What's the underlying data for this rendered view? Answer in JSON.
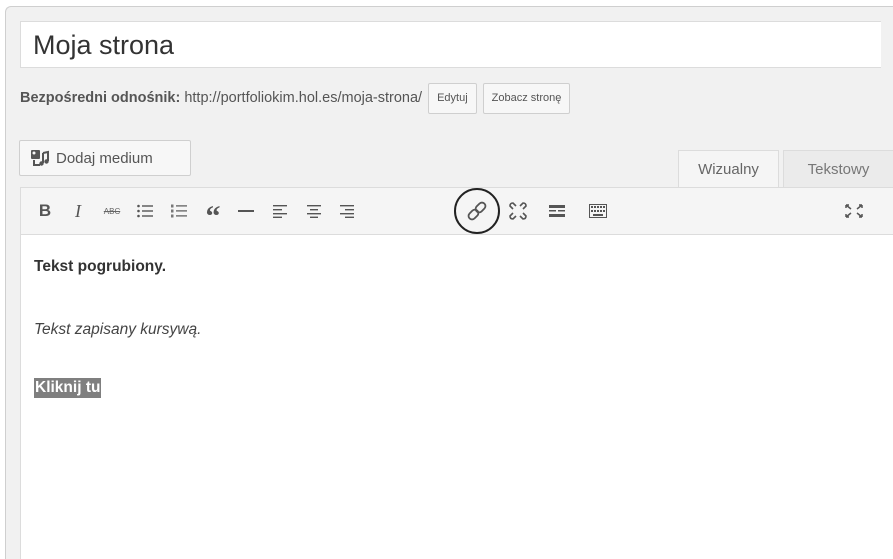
{
  "post": {
    "title": "Moja strona"
  },
  "permalink": {
    "label": "Bezpośredni odnośnik:",
    "url": "http://portfoliokim.hol.es/moja-strona/",
    "edit_label": "Edytuj",
    "view_label": "Zobacz stronę"
  },
  "media": {
    "add_label": "Dodaj medium"
  },
  "tabs": {
    "visual": "Wizualny",
    "text": "Tekstowy"
  },
  "toolbar": {
    "bold": "B",
    "italic": "I",
    "strike": "ABC",
    "quote": "“",
    "buttons": [
      "bold",
      "italic",
      "strikethrough",
      "bullet-list",
      "numbered-list",
      "blockquote",
      "horizontal-line",
      "align-left",
      "align-center",
      "align-right",
      "insert-link",
      "remove-link",
      "read-more",
      "toolbar-toggle",
      "fullscreen"
    ],
    "highlighted": "insert-link"
  },
  "content": {
    "bold_text": "Tekst pogrubiony.",
    "italic_text": "Tekst zapisany kursywą.",
    "selected_text": "Kliknij tu"
  },
  "colors": {
    "frame_bg": "#f1f1f1",
    "selection_bg": "#7f7f7f",
    "highlight_circle": "#222222"
  }
}
